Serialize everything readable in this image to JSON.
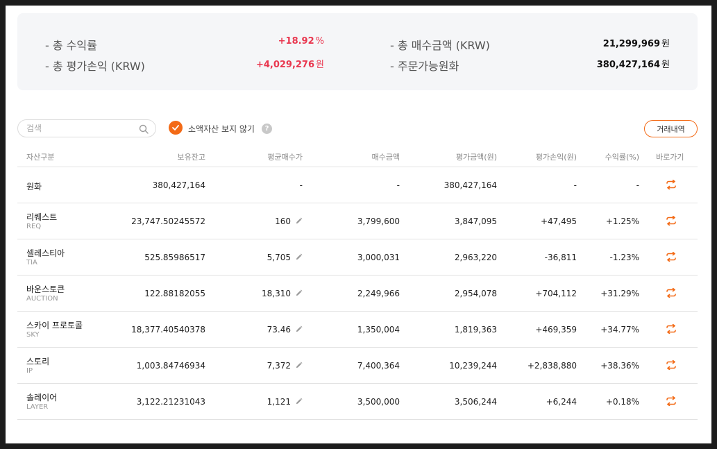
{
  "summary": {
    "total_return_label": "- 총 수익률",
    "total_return_value": "+18.92",
    "total_return_unit": "%",
    "total_pnl_label": "- 총 평가손익 (KRW)",
    "total_pnl_value": "+4,029,276",
    "total_pnl_unit": "원",
    "total_buy_label": "- 총 매수금액 (KRW)",
    "total_buy_value": "21,299,969",
    "total_buy_unit": "원",
    "orderable_label": "- 주문가능원화",
    "orderable_value": "380,427,164",
    "orderable_unit": "원"
  },
  "toolbar": {
    "search_placeholder": "검색",
    "hide_small_label": "소액자산 보지 않기",
    "help_glyph": "?",
    "history_label": "거래내역"
  },
  "columns": [
    "자산구분",
    "보유잔고",
    "평균매수가",
    "매수금액",
    "평가금액(원)",
    "평가손익(원)",
    "수익률(%)",
    "바로가기"
  ],
  "rows": [
    {
      "name": "원화",
      "ticker": "",
      "balance": "380,427,164",
      "avg": "-",
      "buy": "-",
      "eval": "380,427,164",
      "pnl": "-",
      "rate": "-",
      "tone": "none"
    },
    {
      "name": "리퀘스트",
      "ticker": "REQ",
      "balance": "23,747.50245572",
      "avg": "160",
      "buy": "3,799,600",
      "eval": "3,847,095",
      "pnl": "+47,495",
      "rate": "+1.25%",
      "tone": "red"
    },
    {
      "name": "셀레스티아",
      "ticker": "TIA",
      "balance": "525.85986517",
      "avg": "5,705",
      "buy": "3,000,031",
      "eval": "2,963,220",
      "pnl": "-36,811",
      "rate": "-1.23%",
      "tone": "blue"
    },
    {
      "name": "바운스토큰",
      "ticker": "AUCTION",
      "balance": "122.88182055",
      "avg": "18,310",
      "buy": "2,249,966",
      "eval": "2,954,078",
      "pnl": "+704,112",
      "rate": "+31.29%",
      "tone": "red"
    },
    {
      "name": "스카이 프로토콜",
      "ticker": "SKY",
      "balance": "18,377.40540378",
      "avg": "73.46",
      "buy": "1,350,004",
      "eval": "1,819,363",
      "pnl": "+469,359",
      "rate": "+34.77%",
      "tone": "red"
    },
    {
      "name": "스토리",
      "ticker": "IP",
      "balance": "1,003.84746934",
      "avg": "7,372",
      "buy": "7,400,364",
      "eval": "10,239,244",
      "pnl": "+2,838,880",
      "rate": "+38.36%",
      "tone": "red"
    },
    {
      "name": "솔레이어",
      "ticker": "LAYER",
      "balance": "3,122.21231043",
      "avg": "1,121",
      "buy": "3,500,000",
      "eval": "3,506,244",
      "pnl": "+6,244",
      "rate": "+0.18%",
      "tone": "red"
    }
  ],
  "colors": {
    "accent": "#f36a16",
    "up": "#e9374f",
    "down": "#2c7be5",
    "panel": "#f5f6f8"
  }
}
